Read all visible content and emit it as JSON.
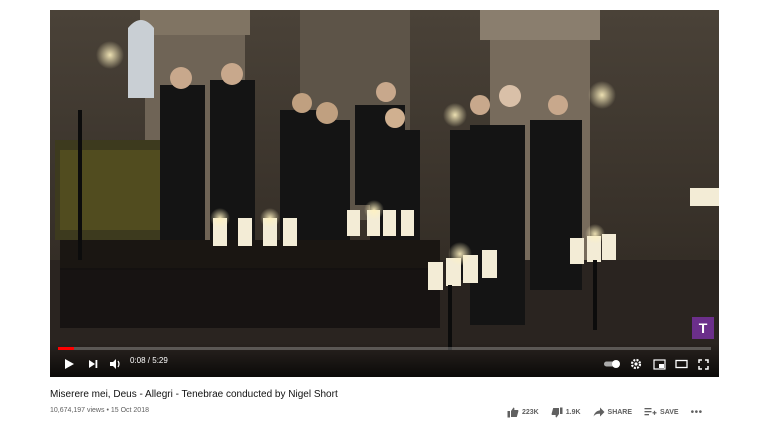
{
  "video": {
    "title": "Miserere mei, Deus - Allegri - Tenebrae conducted by Nigel Short",
    "views": "10,674,197 views",
    "date": "15 Oct 2018",
    "channel_badge": "T",
    "channel_color": "#6b2f8a"
  },
  "player": {
    "time_display": "0:08 / 5:29",
    "progress_fraction": 0.024,
    "progress_color": "#ff0000"
  },
  "actions": {
    "likes": "223K",
    "dislikes": "1.9K",
    "share_label": "SHARE",
    "save_label": "SAVE"
  },
  "icons": [
    "play-icon",
    "next-icon",
    "volume-icon",
    "autoplay-toggle-icon",
    "settings-icon",
    "miniplayer-icon",
    "theater-icon",
    "fullscreen-icon",
    "thumbs-up-icon",
    "thumbs-down-icon",
    "share-icon",
    "save-icon",
    "more-icon"
  ]
}
